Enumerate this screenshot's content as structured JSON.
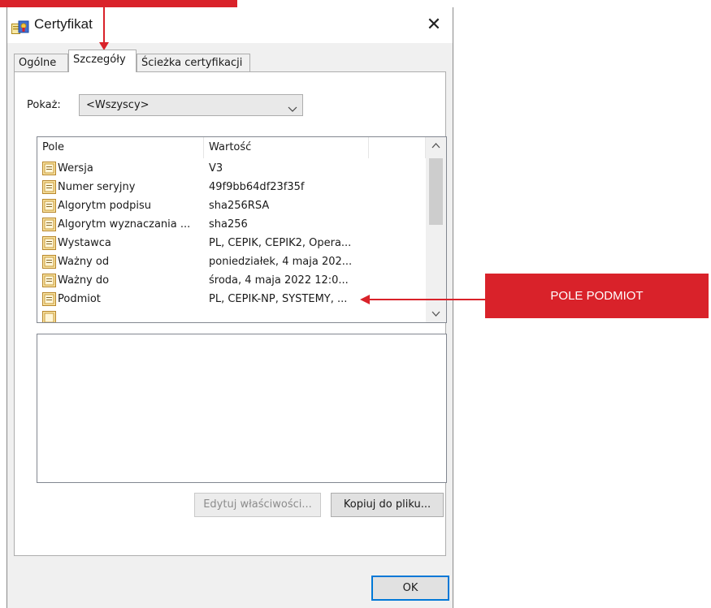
{
  "window": {
    "title": "Certyfikat",
    "close_glyph": "✕"
  },
  "tabs": [
    {
      "label": "Ogólne"
    },
    {
      "label": "Szczegóły",
      "selected": true
    },
    {
      "label": "Ścieżka certyfikacji"
    }
  ],
  "show": {
    "label": "Pokaż:",
    "value": "<Wszyscy>"
  },
  "list": {
    "columns": [
      "Pole",
      "Wartość"
    ],
    "rows": [
      {
        "name": "Wersja",
        "value": "V3"
      },
      {
        "name": "Numer seryjny",
        "value": "49f9bb64df23f35f"
      },
      {
        "name": "Algorytm podpisu",
        "value": "sha256RSA"
      },
      {
        "name": "Algorytm wyznaczania ...",
        "value": "sha256"
      },
      {
        "name": "Wystawca",
        "value": "PL, CEPIK, CEPIK2, Opera..."
      },
      {
        "name": "Ważny od",
        "value": "poniedziałek, 4 maja 202..."
      },
      {
        "name": "Ważny do",
        "value": "środa, 4 maja 2022 12:0..."
      },
      {
        "name": "Podmiot",
        "value": "PL, CEPIK-NP, SYSTEMY, ..."
      }
    ]
  },
  "buttons": {
    "edit": "Edytuj właściwości...",
    "copy": "Kopiuj do pliku...",
    "ok": "OK"
  },
  "annotation": {
    "callout_text": "POLE PODMIOT",
    "color": "#d9222a"
  },
  "icons": {
    "app": "certificate-icon",
    "row": "field-icon"
  }
}
